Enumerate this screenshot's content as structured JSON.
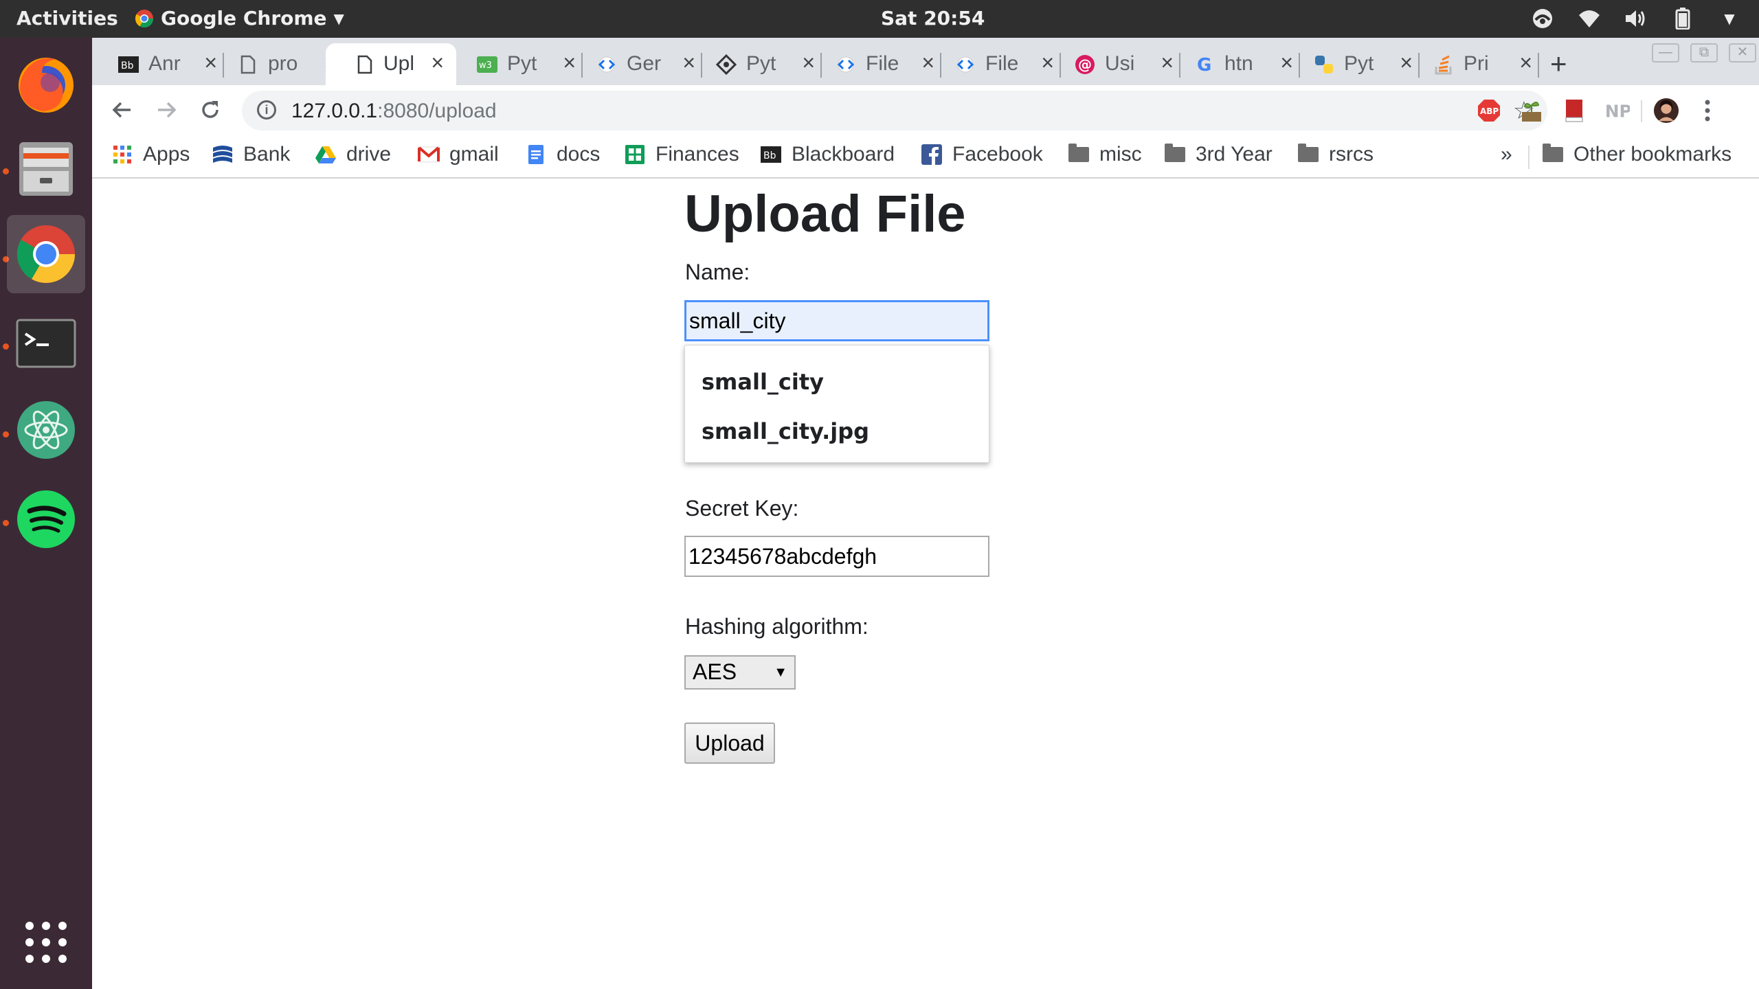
{
  "topbar": {
    "activities": "Activities",
    "app_name": "Google Chrome",
    "clock": "Sat 20:54",
    "tray_icons": [
      "system-update-icon",
      "wifi-icon",
      "volume-icon",
      "battery-icon",
      "power-menu-chevron-icon"
    ]
  },
  "dock": {
    "apps": [
      "firefox",
      "files",
      "chrome",
      "terminal",
      "atom",
      "spotify",
      "show-applications"
    ]
  },
  "tabs": [
    {
      "title": "Anr",
      "favicon": "blackboard-icon"
    },
    {
      "title": "pro",
      "favicon": "page-icon"
    },
    {
      "title": "Upl",
      "favicon": "page-icon",
      "active": true
    },
    {
      "title": "Pyt",
      "favicon": "w3schools-icon"
    },
    {
      "title": "Ger",
      "favicon": "code-icon"
    },
    {
      "title": "Pyt",
      "favicon": "pycryptodome-icon"
    },
    {
      "title": "File",
      "favicon": "code-icon"
    },
    {
      "title": "File",
      "favicon": "code-icon"
    },
    {
      "title": "Usi",
      "favicon": "at-icon"
    },
    {
      "title": "htn",
      "favicon": "google-icon"
    },
    {
      "title": "Pyt",
      "favicon": "python-icon"
    },
    {
      "title": "Pri",
      "favicon": "stackoverflow-icon"
    }
  ],
  "address_bar": {
    "host": "127.0.0.1",
    "path": ":8080/upload"
  },
  "bookmarks": [
    {
      "label": "Apps",
      "icon": "apps-grid-icon"
    },
    {
      "label": "Bank",
      "icon": "bank-icon"
    },
    {
      "label": "drive",
      "icon": "drive-icon"
    },
    {
      "label": "gmail",
      "icon": "gmail-icon"
    },
    {
      "label": "docs",
      "icon": "docs-icon"
    },
    {
      "label": "Finances",
      "icon": "sheets-icon"
    },
    {
      "label": "Blackboard",
      "icon": "blackboard-icon"
    },
    {
      "label": "Facebook",
      "icon": "facebook-icon"
    },
    {
      "label": "misc",
      "icon": "folder-icon"
    },
    {
      "label": "3rd Year",
      "icon": "folder-icon"
    },
    {
      "label": "rsrcs",
      "icon": "folder-icon"
    }
  ],
  "bookmarks_overflow": "»",
  "other_bookmarks": "Other bookmarks",
  "form": {
    "title": "Upload File",
    "name_label": "Name:",
    "name_value": "small_city",
    "autocomplete": [
      "small_city",
      "small_city.jpg"
    ],
    "secret_label": "Secret Key:",
    "secret_value": "12345678abcdefgh",
    "algo_label": "Hashing algorithm:",
    "algo_selected": "AES",
    "upload_label": "Upload"
  },
  "colors": {
    "ubuntu_orange": "#e95420",
    "dock_bg": "#3b2a35",
    "autofill_bg": "#e8f0fe",
    "focus_border": "#4d90fe"
  }
}
